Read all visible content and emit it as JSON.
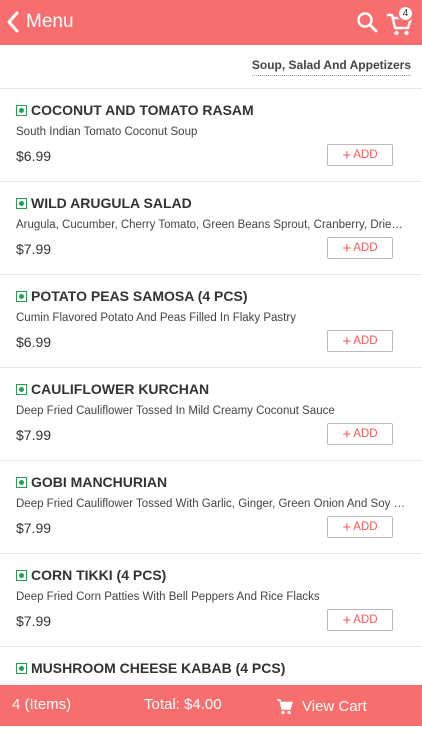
{
  "header": {
    "back_label": "Menu",
    "cart_count": "4",
    "icons": [
      "chevron-left-icon",
      "search-icon",
      "cart-icon"
    ],
    "color": "#f86e6e"
  },
  "category": {
    "title": "Soup, Salad And Appetizers"
  },
  "items": [
    {
      "name": "COCONUT AND TOMATO RASAM",
      "desc": "South Indian Tomato Coconut Soup",
      "price": "$6.99",
      "add_label": "ADD",
      "veg": true
    },
    {
      "name": "WILD ARUGULA SALAD",
      "desc": "Arugula, Cucumber, Cherry Tomato, Green Beans Sprout, Cranberry, Dried Fruits",
      "price": "$7.99",
      "add_label": "ADD",
      "veg": true
    },
    {
      "name": "POTATO PEAS SAMOSA (4 PCS)",
      "desc": "Cumin Flavored Potato And Peas Filled In Flaky Pastry",
      "price": "$6.99",
      "add_label": "ADD",
      "veg": true
    },
    {
      "name": "CAULIFLOWER KURCHAN",
      "desc": "Deep Fried Cauliflower Tossed In Mild Creamy Coconut Sauce",
      "price": "$7.99",
      "add_label": "ADD",
      "veg": true
    },
    {
      "name": "GOBI MANCHURIAN",
      "desc": "Deep Fried Cauliflower Tossed With Garlic, Ginger, Green Onion And Soy Sauce",
      "price": "$7.99",
      "add_label": "ADD",
      "veg": true
    },
    {
      "name": "CORN TIKKI (4 PCS)",
      "desc": "Deep Fried Corn Patties With Bell Peppers And Rice Flacks",
      "price": "$7.99",
      "add_label": "ADD",
      "veg": true
    },
    {
      "name": "MUSHROOM CHEESE KABAB (4 PCS)",
      "desc": "",
      "price": "",
      "add_label": "",
      "veg": true
    }
  ],
  "footer": {
    "items_label": "4 (Items)",
    "total_label": "Total: $4.00",
    "view_cart_label": "View Cart"
  }
}
